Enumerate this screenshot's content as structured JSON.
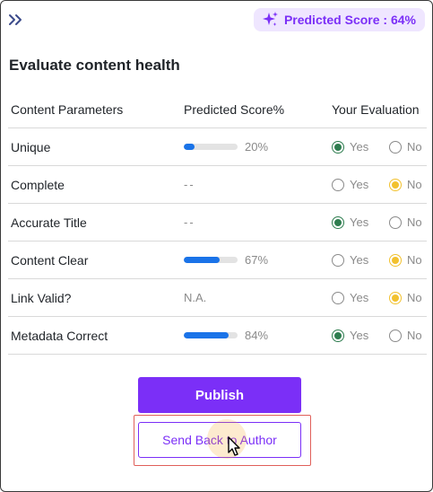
{
  "header": {
    "collapse_icon": "double-chevron-right-icon",
    "score_icon": "sparkle-icon",
    "predicted_score_label": "Predicted Score : 64%",
    "accent_color": "#7b2ff7"
  },
  "title": "Evaluate content health",
  "table": {
    "columns": [
      "Content Parameters",
      "Predicted Score%",
      "Your Evaluation"
    ],
    "option_labels": {
      "yes": "Yes",
      "no": "No"
    },
    "rows": [
      {
        "parameter": "Unique",
        "score_text": "20%",
        "score_fraction": 0.2,
        "selection": "yes"
      },
      {
        "parameter": "Complete",
        "score_text": "--",
        "score_fraction": null,
        "selection": "no"
      },
      {
        "parameter": "Accurate Title",
        "score_text": "--",
        "score_fraction": null,
        "selection": "yes"
      },
      {
        "parameter": "Content Clear",
        "score_text": "67%",
        "score_fraction": 0.67,
        "selection": "no"
      },
      {
        "parameter": "Link Valid?",
        "score_text": "N.A.",
        "score_fraction": null,
        "selection": "no"
      },
      {
        "parameter": "Metadata Correct",
        "score_text": "84%",
        "score_fraction": 0.84,
        "selection": "yes"
      }
    ]
  },
  "actions": {
    "publish_label": "Publish",
    "send_back_label": "Send Back to Author"
  }
}
